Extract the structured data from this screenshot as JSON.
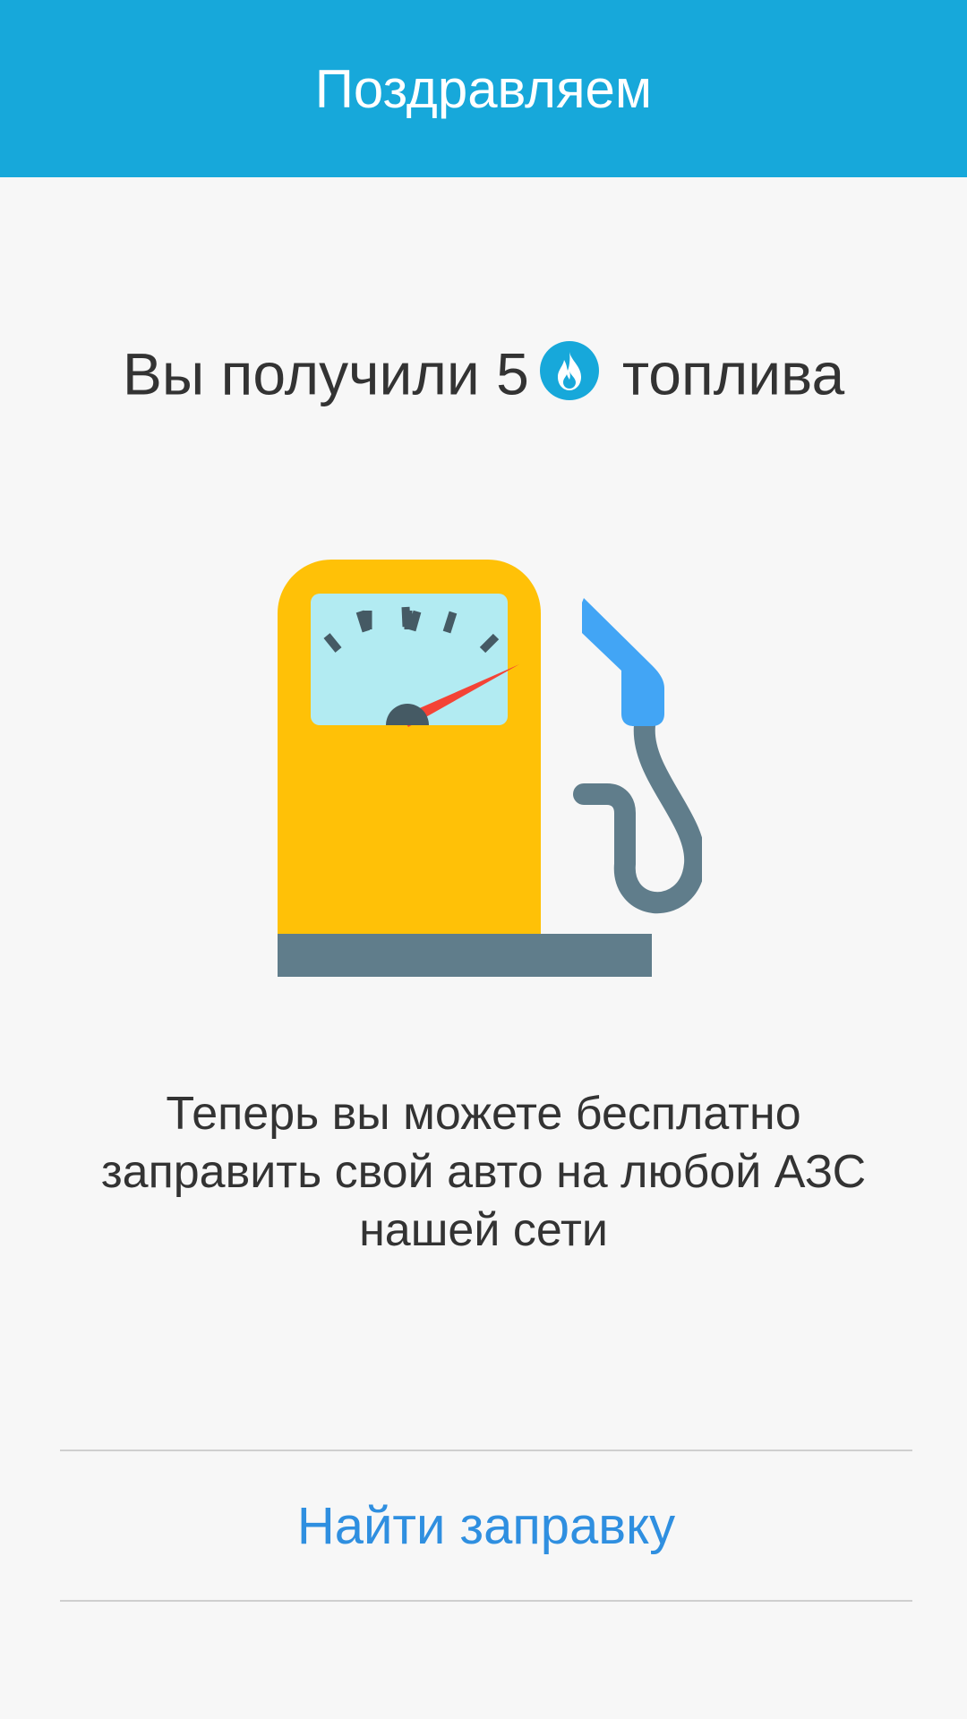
{
  "header": {
    "title": "Поздравляем"
  },
  "reward": {
    "prefix": "Вы получили 5",
    "suffix": "топлива",
    "token_icon": "fuel-flame-icon"
  },
  "illustration": {
    "icon": "gas-pump-icon"
  },
  "message": {
    "text": "Теперь вы можете бесплатно заправить свой авто на любой АЗС нашей сети"
  },
  "actions": {
    "find_station_label": "Найти заправку"
  },
  "colors": {
    "header_bg": "#17a8da",
    "accent_link": "#2f8fe0",
    "pump_body": "#ffc107",
    "pump_base": "#607d8b",
    "gauge_face": "#b2ebf2",
    "nozzle": "#42a5f5",
    "needle": "#f44336"
  }
}
